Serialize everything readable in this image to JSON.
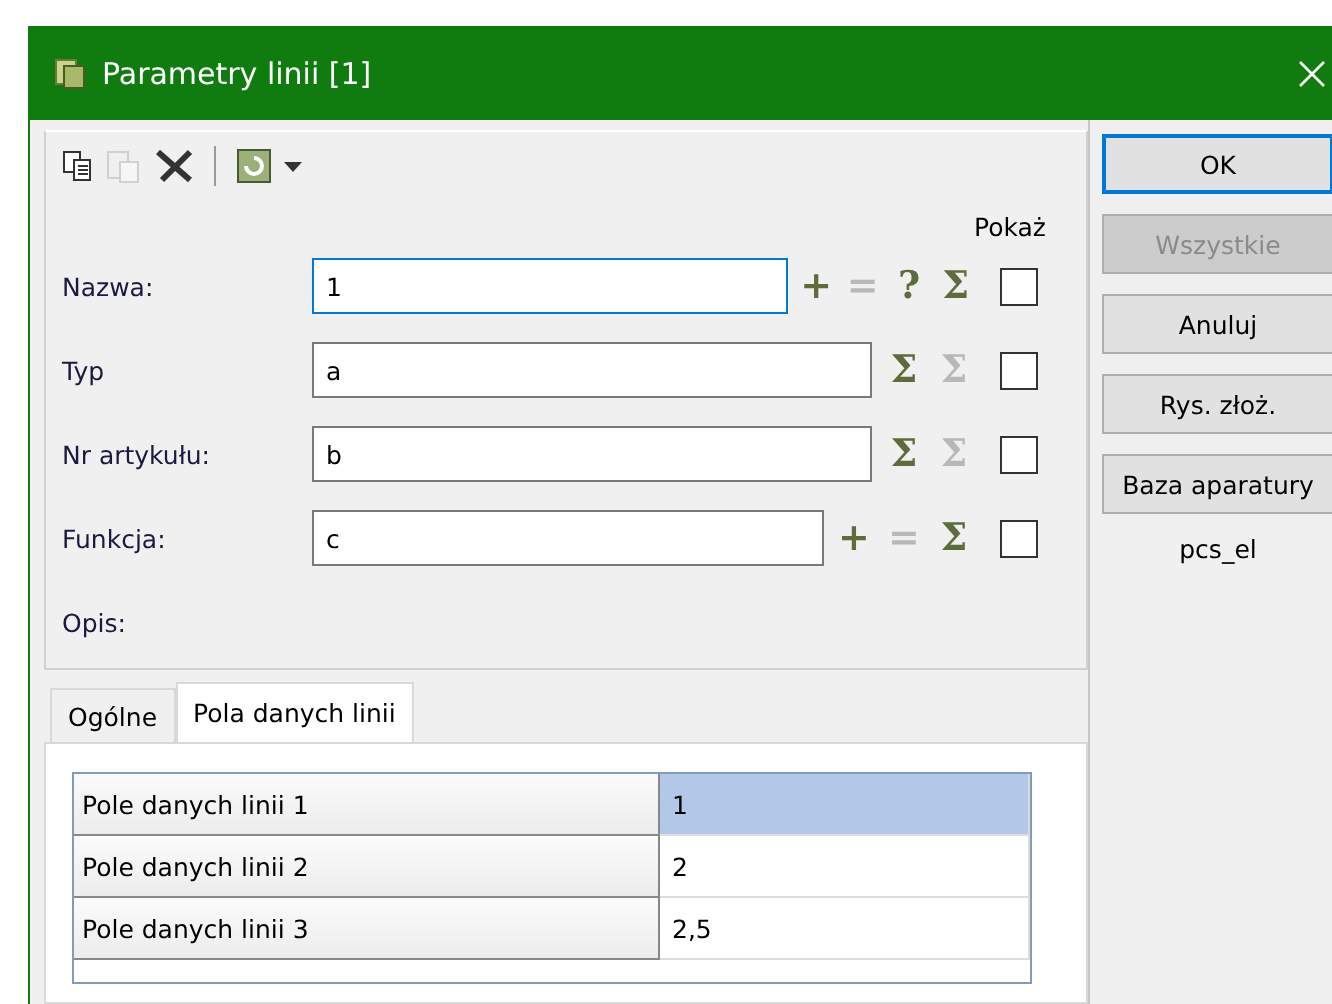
{
  "window": {
    "title": "Parametry linii [1]"
  },
  "toolbar": [
    {
      "kind": "copy",
      "disabled": false
    },
    {
      "kind": "paste",
      "disabled": true
    },
    {
      "kind": "delete",
      "disabled": false
    },
    {
      "kind": "separator"
    },
    {
      "kind": "refresh",
      "disabled": false
    },
    {
      "kind": "dropdown",
      "disabled": false
    }
  ],
  "show_header": "Pokaż",
  "fields": [
    {
      "label": "Nazwa:",
      "value": "1",
      "focused": true,
      "show": false,
      "icons": [
        {
          "glyph": "+",
          "disabled": false
        },
        {
          "glyph": "=",
          "disabled": true
        },
        {
          "glyph": "?",
          "disabled": false
        },
        {
          "glyph": "Σ",
          "disabled": false
        }
      ]
    },
    {
      "label": "Typ",
      "value": "a",
      "focused": false,
      "show": false,
      "icons": [
        {
          "glyph": "Σ",
          "disabled": false
        },
        {
          "glyph": "Σ",
          "disabled": true
        }
      ]
    },
    {
      "label": "Nr artykułu:",
      "value": "b",
      "focused": false,
      "show": false,
      "icons": [
        {
          "glyph": "Σ",
          "disabled": false
        },
        {
          "glyph": "Σ",
          "disabled": true
        }
      ]
    },
    {
      "label": "Funkcja:",
      "value": "c",
      "focused": false,
      "show": false,
      "icons": [
        {
          "glyph": "+",
          "disabled": false
        },
        {
          "glyph": "=",
          "disabled": true
        },
        {
          "glyph": "Σ",
          "disabled": false
        }
      ]
    }
  ],
  "description_label": "Opis:",
  "tabs": [
    {
      "label": "Ogólne",
      "selected": false
    },
    {
      "label": "Pola danych linii",
      "selected": true
    }
  ],
  "table": {
    "rows": [
      {
        "name": "Pole danych linii 1",
        "value": "1",
        "selected": true
      },
      {
        "name": "Pole danych linii 2",
        "value": "2",
        "selected": false
      },
      {
        "name": "Pole danych linii 3",
        "value": "2,5",
        "selected": false
      }
    ]
  },
  "buttons": [
    {
      "label": "OK",
      "default": true,
      "disabled": false
    },
    {
      "label": "Wszystkie",
      "default": false,
      "disabled": true
    },
    {
      "label": "Anuluj",
      "default": false,
      "disabled": false
    },
    {
      "label": "Rys. złoż.",
      "default": false,
      "disabled": false
    },
    {
      "label": "Baza aparatury",
      "default": false,
      "disabled": false
    }
  ],
  "side_note": "pcs_el"
}
